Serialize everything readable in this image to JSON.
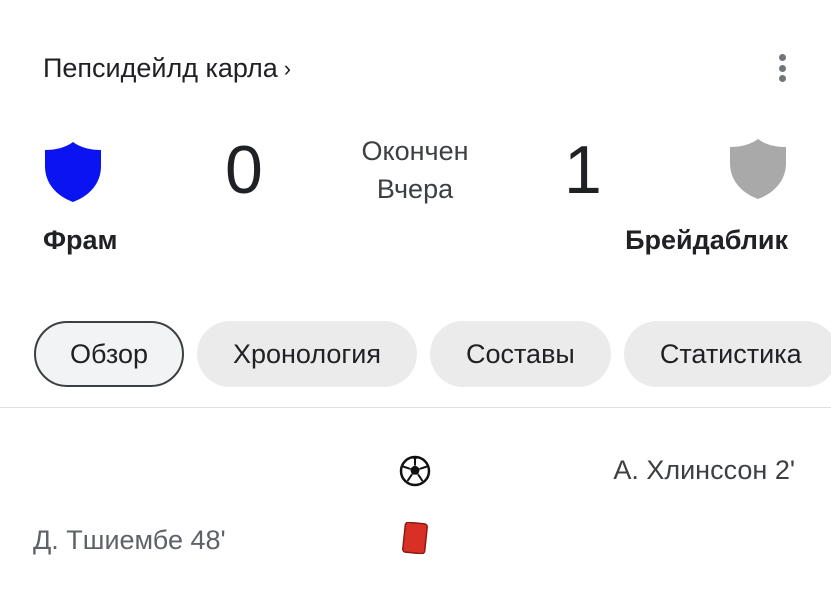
{
  "header": {
    "league_label": "Пепсидейлд карла",
    "chevron": "›",
    "menu_icon": "more-vert-icon"
  },
  "match": {
    "home": {
      "name": "Фрам",
      "score": "0",
      "crest_color": "#0a14f0"
    },
    "away": {
      "name": "Брейдаблик",
      "score": "1",
      "crest_color": "#a9a9a9"
    },
    "status": "Окончен",
    "date": "Вчера"
  },
  "tabs": [
    {
      "label": "Обзор",
      "active": true
    },
    {
      "label": "Хронология",
      "active": false
    },
    {
      "label": "Составы",
      "active": false
    },
    {
      "label": "Статистика",
      "active": false
    }
  ],
  "events": [
    {
      "side": "away",
      "type": "goal",
      "icon": "soccer-ball-icon",
      "text": "А. Хлинссон 2'"
    },
    {
      "side": "home",
      "type": "red-card",
      "icon": "red-card-icon",
      "text": "Д. Тшиембе 48'",
      "color": "#d93025"
    }
  ]
}
